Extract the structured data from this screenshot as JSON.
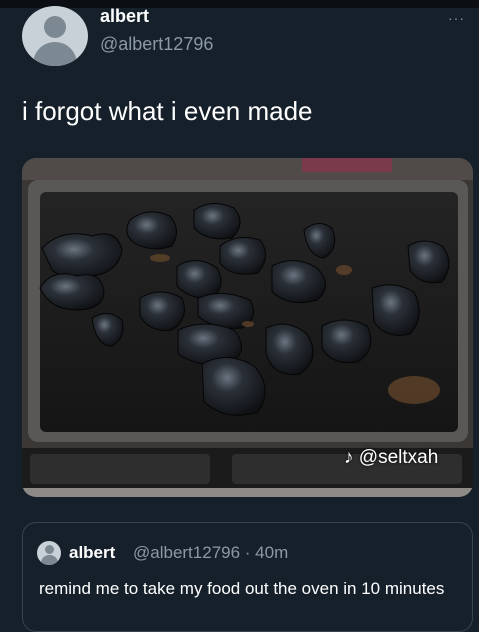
{
  "tweet": {
    "author_name": "albert",
    "author_handle": "@albert12796",
    "text": "i forgot what i even made",
    "more_icon": "···",
    "media": {
      "description_icon": "burnt-food-on-tray",
      "watermark": "@seltxah",
      "watermark_icon": "tiktok-icon"
    }
  },
  "quoted_tweet": {
    "author_name": "albert",
    "meta": "@albert12796 · 40m",
    "text": "remind me to take my food out the oven in 10 minutes"
  },
  "colors": {
    "background": "#15202b",
    "secondary_text": "#8b98a5",
    "border": "#38444d"
  }
}
